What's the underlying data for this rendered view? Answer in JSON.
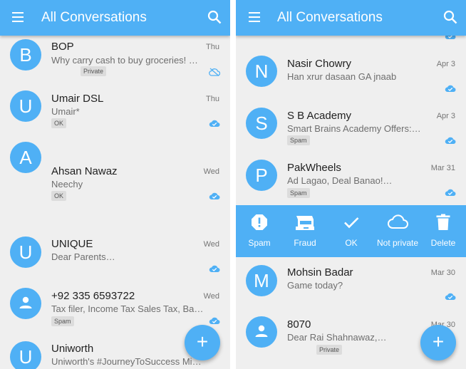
{
  "left": {
    "title": "All Conversations",
    "conversations": [
      {
        "avatar": "B",
        "name": "BOP",
        "date": "Thu",
        "preview": "Why carry cash to buy groceries! No…",
        "tag": "Private",
        "sync": "cloud-off-icon"
      },
      {
        "avatar": "U",
        "name": "Umair DSL",
        "date": "Thu",
        "preview": "Umair*",
        "tag": "OK",
        "sync": "cloud-done-icon"
      },
      {
        "avatar": "A",
        "name": "Ahsan Nawaz",
        "date": "Wed",
        "preview": "Neechy",
        "tag": "OK",
        "sync": "cloud-done-icon"
      },
      {
        "avatar": "U",
        "name": "UNIQUE",
        "date": "Wed",
        "preview": "Dear Parents…",
        "sync": "cloud-done-icon"
      },
      {
        "avatar": "person-icon",
        "name": "+92 335 6593722",
        "date": "Wed",
        "preview": "Tax filer, Income Tax Sales Tax, Banki…",
        "tag": "Spam",
        "sync": "cloud-done-icon"
      },
      {
        "avatar": "U",
        "name": "Uniworth",
        "date": "",
        "preview": "Uniworth's #JourneyToSuccess Mid-…"
      }
    ],
    "fab": "+"
  },
  "right": {
    "title": "All Conversations",
    "conversations": [
      {
        "avatar": "N",
        "name": "Nasir Chowry",
        "date": "Apr 3",
        "preview": "Han xrur dasaan GA jnaab",
        "sync": "cloud-done-icon"
      },
      {
        "avatar": "S",
        "name": "S B Academy",
        "date": "Apr 3",
        "preview": "Smart Brains Academy Offers: …",
        "tag": "Spam",
        "sync": "cloud-done-icon"
      },
      {
        "avatar": "P",
        "name": "PakWheels",
        "date": "Mar 31",
        "preview": "Ad Lagao, Deal Banao!…",
        "tag": "Spam",
        "sync": "cloud-done-icon"
      },
      {
        "avatar": "M",
        "name": "Mohsin Badar",
        "date": "Mar 30",
        "preview": "Game today?",
        "sync": "cloud-done-icon"
      },
      {
        "avatar": "person-icon",
        "name": "8070",
        "date": "Mar 30",
        "preview": "Dear Rai Shahnawaz,…",
        "tag": "Private"
      }
    ],
    "actions": [
      {
        "label": "Spam",
        "icon": "spam-icon"
      },
      {
        "label": "Fraud",
        "icon": "fraud-icon"
      },
      {
        "label": "OK",
        "icon": "check-icon"
      },
      {
        "label": "Not private",
        "icon": "cloud-outline-icon"
      },
      {
        "label": "Delete",
        "icon": "delete-icon"
      }
    ],
    "fab": "+"
  },
  "colors": {
    "primary": "#4fb0f5",
    "background": "#efefef",
    "tag": "#dcdcdc"
  }
}
